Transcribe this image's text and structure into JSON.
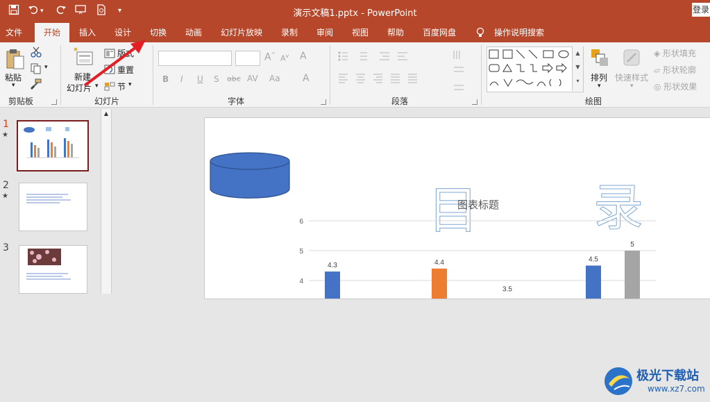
{
  "window": {
    "doc_title": "演示文稿1.pptx  -  PowerPoint",
    "login": "登录"
  },
  "quick_access": [
    "save-icon",
    "undo-icon",
    "redo-icon",
    "slideshow-from-start-icon",
    "print-preview-icon",
    "customize-icon"
  ],
  "tabs": [
    {
      "label": "文件"
    },
    {
      "label": "开始"
    },
    {
      "label": "插入"
    },
    {
      "label": "设计"
    },
    {
      "label": "切换"
    },
    {
      "label": "动画"
    },
    {
      "label": "幻灯片放映"
    },
    {
      "label": "录制"
    },
    {
      "label": "审阅"
    },
    {
      "label": "视图"
    },
    {
      "label": "帮助"
    },
    {
      "label": "百度网盘"
    },
    {
      "label": "操作说明搜索"
    }
  ],
  "ribbon": {
    "clipboard": {
      "paste": "粘贴",
      "group": "剪贴板"
    },
    "slides": {
      "new_slide_1": "新建",
      "new_slide_2": "幻灯片",
      "layout": "版式",
      "reset": "重置",
      "section": "节",
      "group": "幻灯片"
    },
    "font": {
      "group": "字体",
      "buttons": [
        "B",
        "I",
        "U",
        "S",
        "abc",
        "AV",
        "Aa",
        "A"
      ]
    },
    "paragraph": {
      "group": "段落"
    },
    "drawing": {
      "arrange": "排列",
      "quick_styles": "快速样式",
      "shape_fill": "形状填充",
      "shape_outline": "形状轮廓",
      "shape_effects": "形状效果",
      "group": "绘图"
    }
  },
  "slides": [
    {
      "number": "1",
      "star": "★"
    },
    {
      "number": "2",
      "star": "★"
    },
    {
      "number": "3",
      "star": ""
    }
  ],
  "slide": {
    "hollow_left": "目",
    "hollow_right": "录",
    "chart_title": "图表标题",
    "colors": {
      "blue": "#4472c4",
      "orange": "#ed7d31",
      "gray": "#a5a5a5",
      "cylinder": "#4472c4"
    }
  },
  "chart_data": {
    "type": "bar",
    "title": "图表标题",
    "y_ticks": [
      "6",
      "5",
      "4"
    ],
    "ylim": [
      0,
      6
    ],
    "series": [
      {
        "values": [
          4.3,
          3.5,
          4.5
        ]
      },
      {
        "values": [
          4.4
        ]
      },
      {
        "values": [
          5
        ]
      }
    ],
    "data_labels": [
      "4.3",
      "4.4",
      "3.5",
      "4.5",
      "5"
    ]
  },
  "watermark": {
    "brand": "极光下载站",
    "url": "www.xz7.com"
  }
}
